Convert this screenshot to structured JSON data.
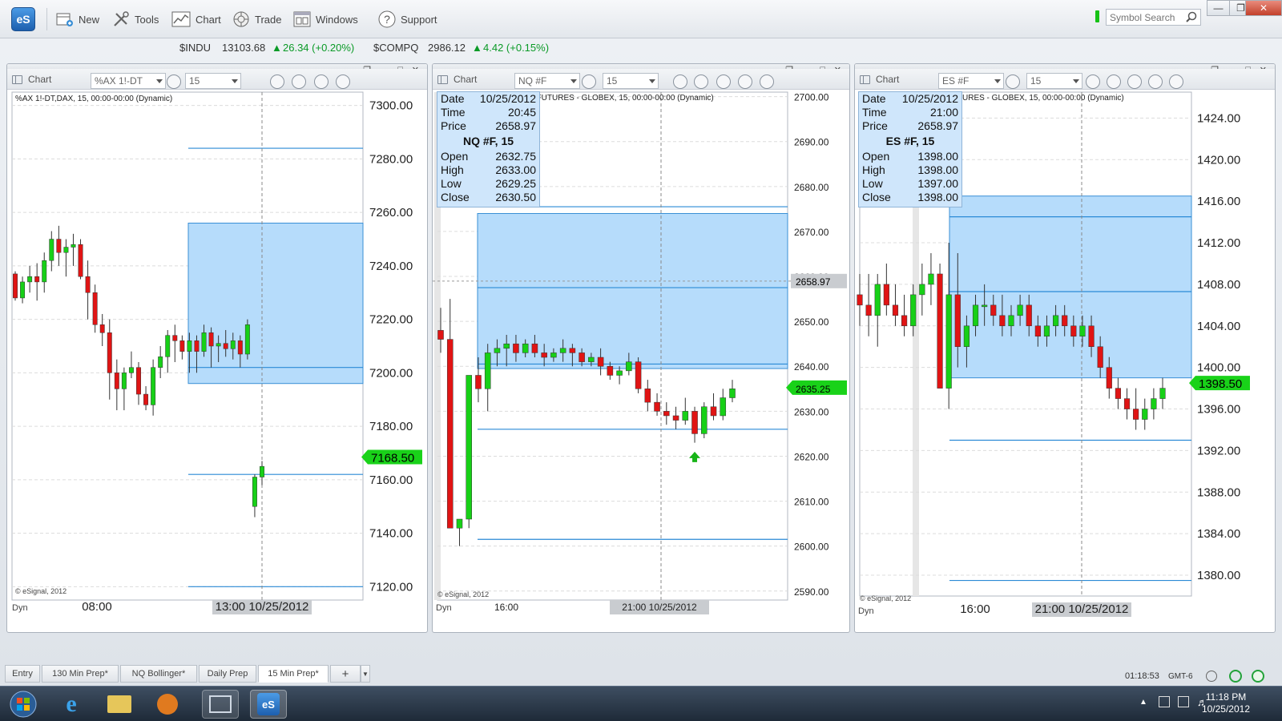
{
  "app": {
    "logo": "eS"
  },
  "toolbar": {
    "new_label": "New",
    "tools_label": "Tools",
    "chart_label": "Chart",
    "trade_label": "Trade",
    "windows_label": "Windows",
    "support_label": "Support",
    "search_placeholder": "Symbol Search"
  },
  "tickers": [
    {
      "symbol": "$INDU",
      "price": "13103.68",
      "change": "26.34 (+0.20%)"
    },
    {
      "symbol": "$COMPQ",
      "price": "2986.12",
      "change": "4.42 (+0.15%)"
    }
  ],
  "panels": [
    {
      "label": "Chart",
      "symbol": "%AX 1!-DT",
      "interval": "15",
      "desc": "%AX 1!-DT,DAX, 15, 00:00-00:00 (Dynamic)",
      "watermark": "© eSignal, 2012",
      "dyn": "Dyn",
      "cursor_label": "13:00 10/25/2012",
      "price_tag": "7168.50",
      "tag_color": "#19d219"
    },
    {
      "label": "Chart",
      "symbol": "NQ #F",
      "interval": "15",
      "desc": "I FUTURES - GLOBEX, 15, 00:00-00:00 (Dynamic)",
      "watermark": "© eSignal, 2012",
      "dyn": "Dyn",
      "cursor_label": "21:00 10/25/2012",
      "price_tag": "2635.25",
      "cursor_price": "2658.97",
      "tag_color": "#19d219",
      "info": {
        "date_label": "Date",
        "date": "10/25/2012",
        "time_label": "Time",
        "time": "20:45",
        "price_label": "Price",
        "price": "2658.97",
        "title": "NQ #F, 15",
        "open_label": "Open",
        "open": "2632.75",
        "high_label": "High",
        "high": "2633.00",
        "low_label": "Low",
        "low": "2629.25",
        "close_label": "Close",
        "close": "2630.50"
      }
    },
    {
      "label": "Chart",
      "symbol": "ES #F",
      "interval": "15",
      "desc": "URES - GLOBEX, 15, 00:00-00:00 (Dynamic)",
      "watermark": "© eSignal, 2012",
      "dyn": "Dyn",
      "cursor_label": "21:00 10/25/2012",
      "price_tag": "1398.50",
      "tag_color": "#19d219",
      "info": {
        "date_label": "Date",
        "date": "10/25/2012",
        "time_label": "Time",
        "time": "21:00",
        "price_label": "Price",
        "price": "2658.97",
        "title": "ES #F, 15",
        "open_label": "Open",
        "open": "1398.00",
        "high_label": "High",
        "high": "1398.00",
        "low_label": "Low",
        "low": "1397.00",
        "close_label": "Close",
        "close": "1398.00"
      }
    }
  ],
  "chart_data": [
    {
      "type": "candlestick",
      "title": "%AX 1!-DT,DAX, 15, 00:00-00:00 (Dynamic)",
      "ylim": [
        7115,
        7305
      ],
      "y_ticks": [
        "7300.00",
        "7280.00",
        "7260.00",
        "7240.00",
        "7220.00",
        "7200.00",
        "7180.00",
        "7160.00",
        "7140.00",
        "7120.00"
      ],
      "x_ticks": [
        "08:00",
        "13:00 10/25/2012"
      ],
      "last_price": 7168.5,
      "box": [
        7196,
        7256
      ],
      "levels": [
        7284,
        7202,
        7162,
        7120
      ],
      "candles": [
        [
          7237,
          7238,
          7227,
          7228
        ],
        [
          7228,
          7236,
          7226,
          7234
        ],
        [
          7234,
          7240,
          7230,
          7236
        ],
        [
          7236,
          7241,
          7227,
          7234
        ],
        [
          7234,
          7245,
          7230,
          7242
        ],
        [
          7242,
          7253,
          7238,
          7250
        ],
        [
          7250,
          7255,
          7240,
          7245
        ],
        [
          7245,
          7250,
          7236,
          7247
        ],
        [
          7247,
          7252,
          7240,
          7248
        ],
        [
          7248,
          7250,
          7235,
          7236
        ],
        [
          7236,
          7242,
          7220,
          7230
        ],
        [
          7230,
          7233,
          7215,
          7218
        ],
        [
          7218,
          7222,
          7210,
          7215
        ],
        [
          7215,
          7220,
          7190,
          7200
        ],
        [
          7200,
          7205,
          7186,
          7194
        ],
        [
          7194,
          7202,
          7186,
          7200
        ],
        [
          7200,
          7208,
          7198,
          7202
        ],
        [
          7202,
          7204,
          7188,
          7192
        ],
        [
          7192,
          7195,
          7186,
          7188
        ],
        [
          7188,
          7205,
          7184,
          7202
        ],
        [
          7202,
          7210,
          7198,
          7206
        ],
        [
          7206,
          7216,
          7200,
          7214
        ],
        [
          7214,
          7218,
          7204,
          7212
        ],
        [
          7212,
          7214,
          7205,
          7208
        ],
        [
          7208,
          7215,
          7200,
          7212
        ],
        [
          7212,
          7214,
          7200,
          7208
        ],
        [
          7208,
          7218,
          7206,
          7215
        ],
        [
          7215,
          7217,
          7202,
          7210
        ],
        [
          7210,
          7214,
          7204,
          7211
        ],
        [
          7211,
          7216,
          7206,
          7209
        ],
        [
          7209,
          7215,
          7205,
          7212
        ],
        [
          7212,
          7214,
          7202,
          7207
        ],
        [
          7207,
          7220,
          7205,
          7218
        ],
        [
          7150,
          7162,
          7146,
          7161
        ],
        [
          7161,
          7167,
          7158,
          7165
        ]
      ]
    },
    {
      "type": "candlestick",
      "title": "I FUTURES - GLOBEX, 15, 00:00-00:00 (Dynamic)",
      "ylim": [
        2588,
        2701
      ],
      "y_ticks": [
        "2700.00",
        "2690.00",
        "2680.00",
        "2670.00",
        "2660.00",
        "2650.00",
        "2640.00",
        "2630.00",
        "2620.00",
        "2610.00",
        "2600.00",
        "2590.00"
      ],
      "x_ticks": [
        "16:00",
        "21:00 10/25/2012"
      ],
      "last_price": 2635.25,
      "box": [
        2639.5,
        2674
      ],
      "levels": [
        2675.5,
        2657.5,
        2640.5,
        2626,
        2601.5
      ],
      "candles": [
        [
          2648,
          2653,
          2643,
          2646
        ],
        [
          2646,
          2655,
          2605,
          2604
        ],
        [
          2604,
          2606,
          2600,
          2606
        ],
        [
          2606,
          2638,
          2604,
          2638
        ],
        [
          2638,
          2642,
          2632,
          2635
        ],
        [
          2635,
          2645,
          2630,
          2643
        ],
        [
          2643,
          2646,
          2640,
          2644
        ],
        [
          2644,
          2647,
          2640,
          2645
        ],
        [
          2645,
          2647,
          2641,
          2643
        ],
        [
          2643,
          2646,
          2642,
          2645
        ],
        [
          2645,
          2647,
          2642,
          2643
        ],
        [
          2643,
          2645,
          2640,
          2642
        ],
        [
          2642,
          2644,
          2641,
          2643
        ],
        [
          2643,
          2646,
          2641,
          2644
        ],
        [
          2644,
          2645,
          2640,
          2643
        ],
        [
          2643,
          2644,
          2640,
          2641
        ],
        [
          2641,
          2643,
          2640,
          2642
        ],
        [
          2642,
          2644,
          2638,
          2640
        ],
        [
          2640,
          2641,
          2637,
          2638
        ],
        [
          2638,
          2640,
          2636,
          2639
        ],
        [
          2639,
          2643,
          2638,
          2641
        ],
        [
          2641,
          2642,
          2634,
          2635
        ],
        [
          2635,
          2637,
          2630,
          2632
        ],
        [
          2632,
          2634,
          2629,
          2630
        ],
        [
          2630,
          2632,
          2627,
          2629
        ],
        [
          2629,
          2631,
          2626,
          2628
        ],
        [
          2628,
          2633,
          2627,
          2630
        ],
        [
          2630,
          2631,
          2623,
          2625
        ],
        [
          2625,
          2632,
          2624,
          2631
        ],
        [
          2631,
          2634,
          2628,
          2629
        ],
        [
          2629,
          2635,
          2628,
          2633
        ],
        [
          2633,
          2637,
          2632,
          2635
        ]
      ]
    },
    {
      "type": "candlestick",
      "title": "URES - GLOBEX, 15, 00:00-00:00 (Dynamic)",
      "ylim": [
        1378,
        1426.5
      ],
      "y_ticks": [
        "1424.00",
        "1420.00",
        "1416.00",
        "1412.00",
        "1408.00",
        "1404.00",
        "1400.00",
        "1396.00",
        "1392.00",
        "1388.00",
        "1384.00",
        "1380.00"
      ],
      "x_ticks": [
        "16:00",
        "21:00 10/25/2012"
      ],
      "last_price": 1398.5,
      "box": [
        1399,
        1416.5
      ],
      "levels": [
        1414.5,
        1407.3,
        1393,
        1379.5
      ],
      "candles": [
        [
          1407,
          1409,
          1404,
          1406
        ],
        [
          1406,
          1409,
          1403,
          1405
        ],
        [
          1405,
          1409,
          1402,
          1408
        ],
        [
          1408,
          1410,
          1405,
          1406
        ],
        [
          1406,
          1408,
          1404,
          1405
        ],
        [
          1405,
          1407,
          1403,
          1404
        ],
        [
          1404,
          1408,
          1403,
          1407
        ],
        [
          1407,
          1410,
          1405,
          1408
        ],
        [
          1408,
          1411,
          1406,
          1409
        ],
        [
          1409,
          1410,
          1398,
          1398
        ],
        [
          1398,
          1412,
          1396,
          1407
        ],
        [
          1407,
          1411,
          1400,
          1402
        ],
        [
          1402,
          1405,
          1400,
          1404
        ],
        [
          1404,
          1407,
          1403,
          1406
        ],
        [
          1406,
          1408,
          1404,
          1406
        ],
        [
          1406,
          1407,
          1404,
          1405
        ],
        [
          1405,
          1407,
          1403,
          1404
        ],
        [
          1404,
          1406,
          1403,
          1405
        ],
        [
          1405,
          1407,
          1404,
          1406
        ],
        [
          1406,
          1407,
          1403,
          1404
        ],
        [
          1404,
          1405,
          1402,
          1403
        ],
        [
          1403,
          1405,
          1402,
          1404
        ],
        [
          1404,
          1406,
          1403,
          1405
        ],
        [
          1405,
          1406,
          1403,
          1404
        ],
        [
          1404,
          1405,
          1402,
          1403
        ],
        [
          1403,
          1405,
          1402,
          1404
        ],
        [
          1404,
          1405,
          1401,
          1402
        ],
        [
          1402,
          1403,
          1399,
          1400
        ],
        [
          1400,
          1401,
          1397,
          1398
        ],
        [
          1398,
          1399,
          1396,
          1397
        ],
        [
          1397,
          1398,
          1395,
          1396
        ],
        [
          1396,
          1398,
          1394,
          1395
        ],
        [
          1395,
          1397,
          1394,
          1396
        ],
        [
          1396,
          1398,
          1395,
          1397
        ],
        [
          1397,
          1399,
          1396,
          1398
        ]
      ]
    }
  ],
  "tabs": [
    "Entry",
    "130 Min Prep*",
    "NQ Bollinger*",
    "Daily Prep",
    "15 Min Prep*"
  ],
  "status": {
    "time": "01:18:53",
    "zone": "GMT-6"
  },
  "taskbar": {
    "time": "11:18 PM",
    "date": "10/25/2012",
    "es_label": "eS"
  }
}
